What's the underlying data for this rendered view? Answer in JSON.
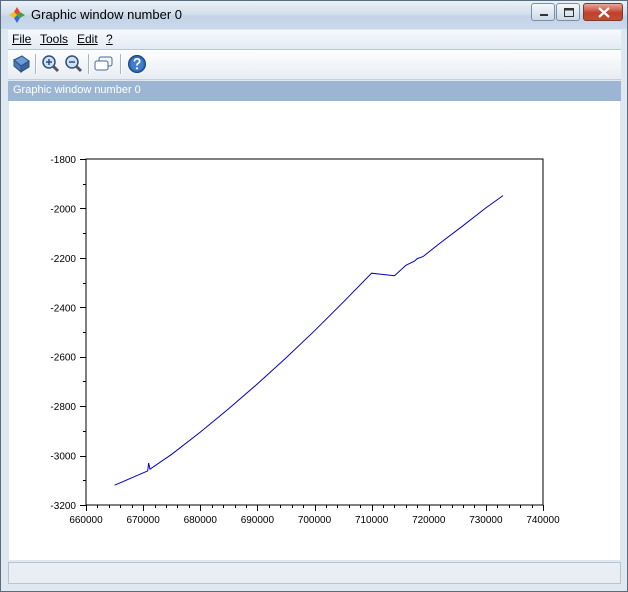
{
  "window": {
    "title": "Graphic window number 0"
  },
  "menubar": {
    "file": "File",
    "tools": "Tools",
    "edit": "Edit",
    "help": "?"
  },
  "toolbar": {
    "icons": [
      "rotate-icon",
      "zoom-in-icon",
      "zoom-out-icon",
      "datatip-icon",
      "help-icon"
    ]
  },
  "dock": {
    "title": "Graphic window number 0"
  },
  "status": {
    "text": ""
  },
  "colors": {
    "curve": "#0000cc",
    "dock_bar": "#9cb5d3",
    "titlebar": "#d3dfec"
  },
  "chart_data": {
    "type": "line",
    "title": "",
    "xlabel": "",
    "ylabel": "",
    "xlim": [
      660000,
      740000
    ],
    "ylim": [
      -3200,
      -1800
    ],
    "xticks": [
      660000,
      670000,
      680000,
      690000,
      700000,
      710000,
      720000,
      730000,
      740000
    ],
    "yticks": [
      -1800,
      -2000,
      -2200,
      -2400,
      -2600,
      -2800,
      -3000,
      -3200
    ],
    "xtick_labels": [
      "660000",
      "670000",
      "680000",
      "690000",
      "700000",
      "710000",
      "720000",
      "730000",
      "740000"
    ],
    "ytick_labels": [
      "-1800",
      "-2000",
      "-2200",
      "-2400",
      "-2600",
      "-2800",
      "-3000",
      "-3200"
    ],
    "grid": false,
    "series": [
      {
        "name": "",
        "x": [
          665000,
          668000,
          670800,
          670950,
          671200,
          675000,
          680000,
          685000,
          690000,
          695000,
          700000,
          705000,
          710000,
          714000,
          716000,
          717500,
          718000,
          719000,
          722000,
          726000,
          730000,
          733000
        ],
        "y": [
          -3120,
          -3090,
          -3062,
          -3030,
          -3055,
          -2995,
          -2905,
          -2810,
          -2710,
          -2605,
          -2495,
          -2380,
          -2262,
          -2272,
          -2230,
          -2213,
          -2203,
          -2195,
          -2140,
          -2070,
          -1998,
          -1948
        ]
      }
    ]
  }
}
